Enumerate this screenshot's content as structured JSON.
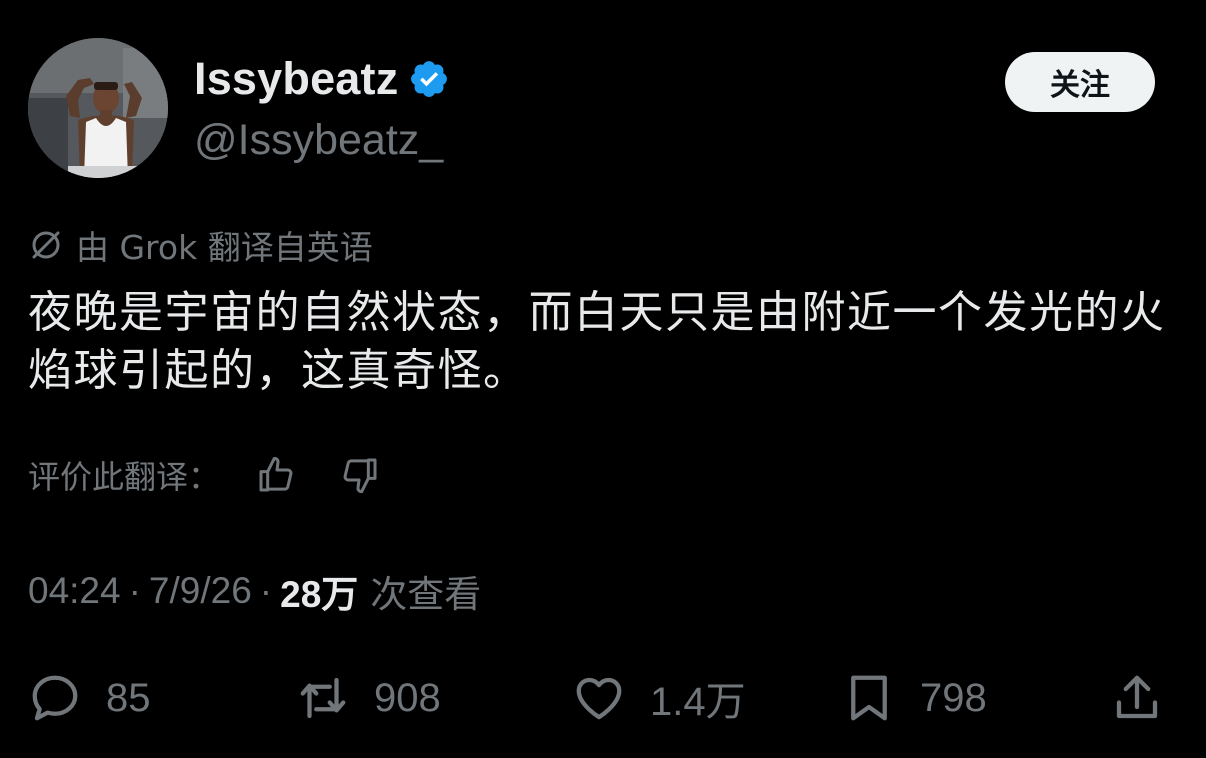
{
  "author": {
    "display_name": "Issybeatz",
    "handle": "@Issybeatz_",
    "verified": true
  },
  "header": {
    "follow_label": "关注"
  },
  "translation": {
    "note": "由 Grok 翻译自英语",
    "rate_label": "评价此翻译："
  },
  "tweet": {
    "text": "夜晚是宇宙的自然状态，而白天只是由附近一个发光的火焰球引起的，这真奇怪。"
  },
  "meta": {
    "time": "04:24",
    "separator": "·",
    "date": "7/9/26",
    "views_count": "28万",
    "views_label": "次查看"
  },
  "actions": {
    "replies": "85",
    "retweets": "908",
    "likes": "1.4万",
    "bookmarks": "798"
  },
  "icons": {
    "verified": "verified-badge-icon",
    "translate": "translate-icon",
    "thumbs_up": "thumbs-up-icon",
    "thumbs_down": "thumbs-down-icon",
    "reply": "reply-icon",
    "retweet": "retweet-icon",
    "like": "heart-icon",
    "bookmark": "bookmark-icon",
    "share": "share-icon"
  },
  "colors": {
    "background": "#000000",
    "primary_text": "#e7e9ea",
    "secondary_text": "#71767b",
    "verified_blue": "#1d9bf0",
    "follow_button_bg": "#eff3f4"
  }
}
